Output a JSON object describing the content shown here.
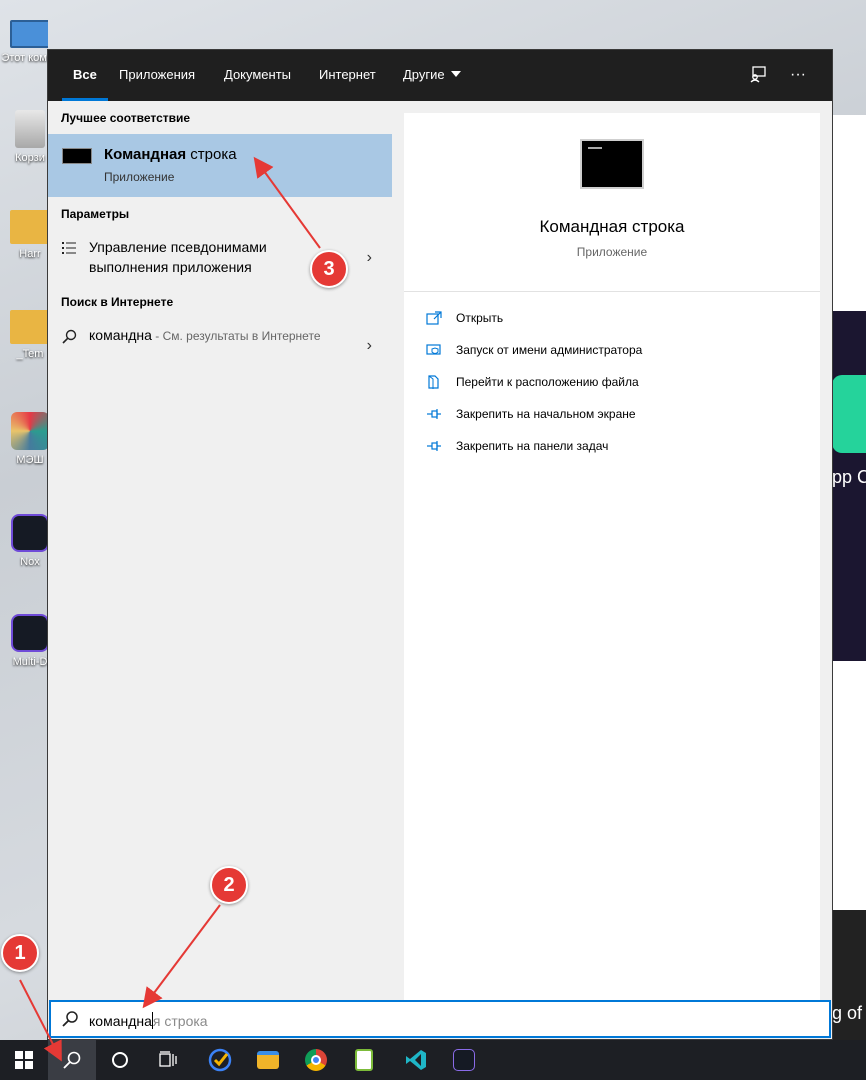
{
  "desktop": {
    "icons": [
      {
        "label": "Этот компь",
        "kind": "pc-icon"
      },
      {
        "label": "Корзи",
        "kind": "recycle-bin-icon"
      },
      {
        "label": "Harr",
        "kind": "folder-icon"
      },
      {
        "label": "_Tem",
        "kind": "folder-icon"
      },
      {
        "label": "МЭШ",
        "kind": "mesh-icon"
      },
      {
        "label": "Nox",
        "kind": "nox-icon"
      },
      {
        "label": "Multi-D",
        "kind": "nox-multi-icon"
      }
    ],
    "bg_text_1": "pp C",
    "bg_text_2": "g of A"
  },
  "search_panel": {
    "tabs": [
      {
        "label": "Все",
        "active": true
      },
      {
        "label": "Приложения"
      },
      {
        "label": "Документы"
      },
      {
        "label": "Интернет"
      },
      {
        "label": "Другие",
        "has_caret": true
      }
    ],
    "feedback_icon": "feedback-icon",
    "more_label": "···",
    "best_match_header": "Лучшее соответствие",
    "best_match": {
      "title_bold": "Командная",
      "title_rest": " строка",
      "subtitle": "Приложение"
    },
    "settings_header": "Параметры",
    "settings_item": "Управление псевдонимами выполнения приложения",
    "web_header": "Поиск в Интернете",
    "web_item": {
      "query": "командна",
      "hint": " - См. результаты в Интернете"
    },
    "preview": {
      "title": "Командная строка",
      "subtitle": "Приложение",
      "actions": [
        {
          "label": "Открыть",
          "icon": "open-icon"
        },
        {
          "label": "Запуск от имени администратора",
          "icon": "shield-icon"
        },
        {
          "label": "Перейти к расположению файла",
          "icon": "file-location-icon"
        },
        {
          "label": "Закрепить на начальном экране",
          "icon": "pin-icon"
        },
        {
          "label": "Закрепить на панели задач",
          "icon": "pin-icon"
        }
      ]
    },
    "search_box": {
      "typed": "командна",
      "suggestion": "я строка"
    }
  },
  "taskbar": {
    "items": [
      "start-button",
      "search-button",
      "cortana-button",
      "task-view-button",
      "todo-app",
      "file-explorer",
      "chrome",
      "notepad-plus",
      "visual-studio-code",
      "nox-player"
    ]
  },
  "annotations": [
    {
      "number": "1"
    },
    {
      "number": "2"
    },
    {
      "number": "3"
    }
  ],
  "colors": {
    "accent": "#0078d7",
    "selection": "#a9c8e4",
    "annotation": "#e53935"
  }
}
